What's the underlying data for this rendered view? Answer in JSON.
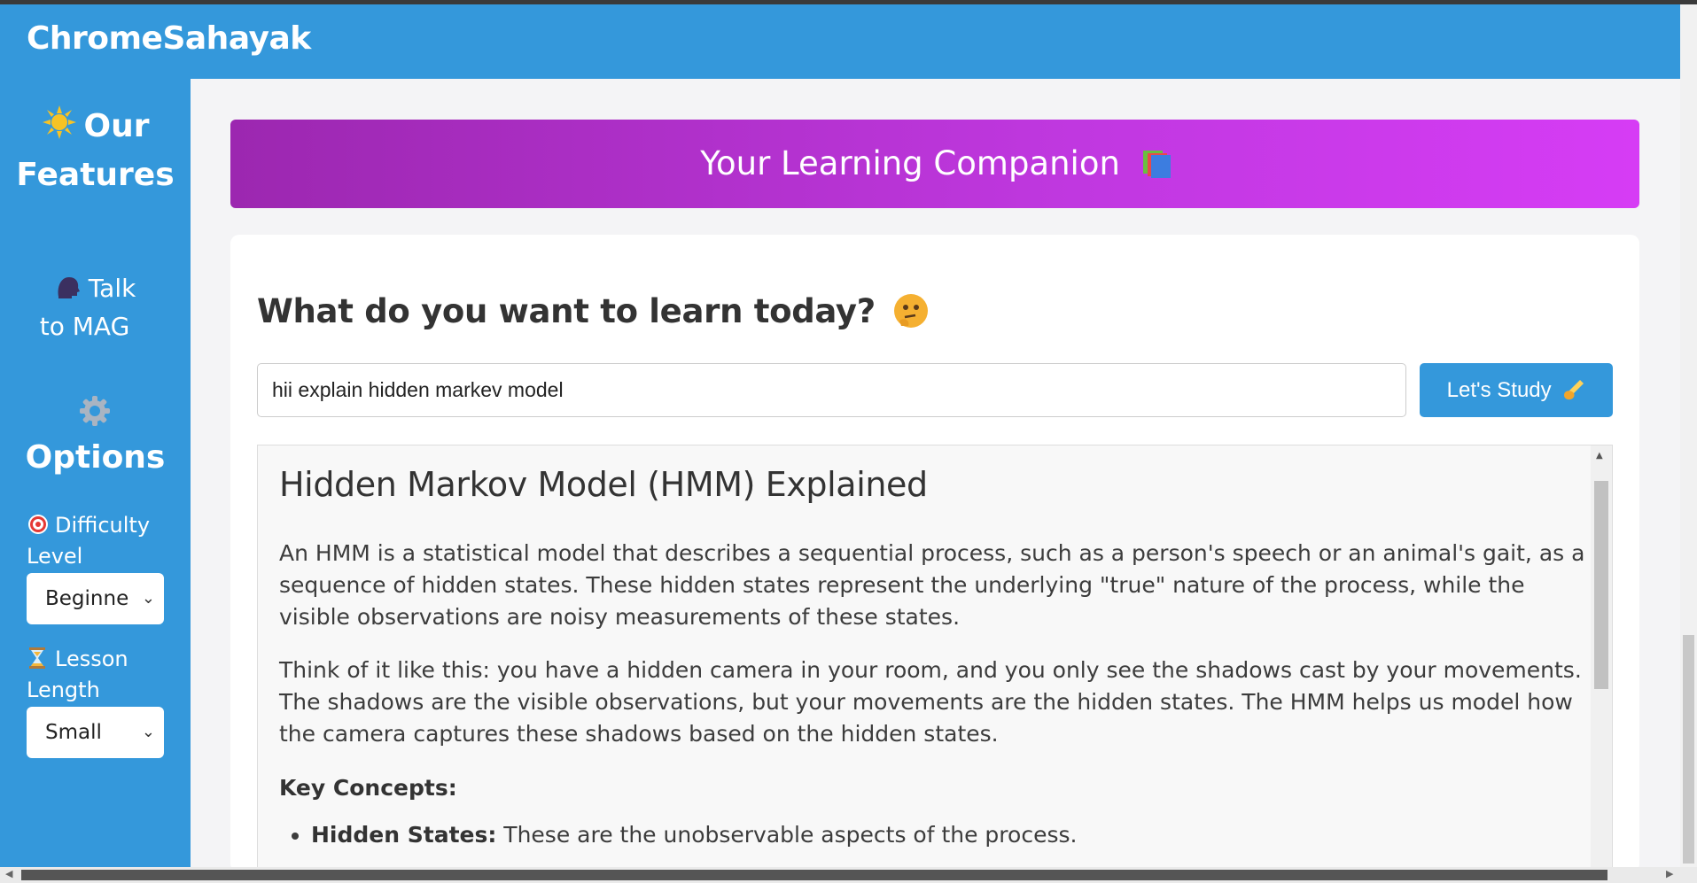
{
  "app": {
    "title": "ChromeSahayak"
  },
  "sidebar": {
    "features_icon": "sun-icon",
    "features_heading_line1": "Our",
    "features_heading_line2": "Features",
    "talk_icon": "speaking-head-icon",
    "talk_line1": "Talk",
    "talk_line2": "to MAG",
    "options_icon": "gear-icon",
    "options_heading": "Options",
    "difficulty": {
      "icon": "target-icon",
      "label_line1": "Difficulty",
      "label_line2": "Level",
      "selected": "Beginner"
    },
    "length": {
      "icon": "hourglass-icon",
      "label_line1": "Lesson",
      "label_line2": "Length",
      "selected": "Small"
    }
  },
  "banner": {
    "title": "Your Learning Companion",
    "icon": "books-icon"
  },
  "main": {
    "question": "What do you want to learn today?",
    "question_icon": "thinking-face-icon",
    "input_value": "hii explain hidden markev model",
    "button_label": "Let's Study",
    "button_icon": "writing-hand-icon"
  },
  "result": {
    "title": "Hidden Markov Model (HMM) Explained",
    "para1": "An HMM is a statistical model that describes a sequential process, such as a person's speech or an animal's gait, as a sequence of hidden states. These hidden states represent the underlying \"true\" nature of the process, while the visible observations are noisy measurements of these states.",
    "para2": "Think of it like this: you have a hidden camera in your room, and you only see the shadows cast by your movements. The shadows are the visible observations, but your movements are the hidden states. The HMM helps us model how the camera captures these shadows based on the hidden states.",
    "key_concepts_heading": "Key Concepts:",
    "list": [
      {
        "term": "Hidden States:",
        "text": " These are the unobservable aspects of the process."
      }
    ]
  },
  "colors": {
    "primary": "#3498db",
    "banner_start": "#9c27b0",
    "banner_end": "#d63cf5"
  }
}
